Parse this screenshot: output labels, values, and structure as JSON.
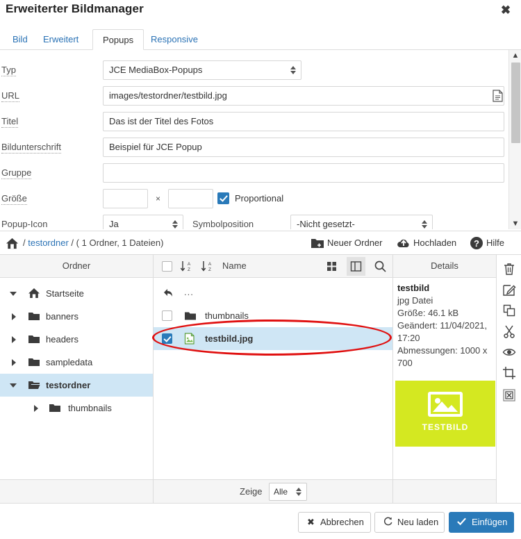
{
  "dialog": {
    "title": "Erweiterter Bildmanager",
    "close_icon": "close-icon"
  },
  "tabs": [
    {
      "label": "Bild",
      "active": false
    },
    {
      "label": "Erweitert",
      "active": false
    },
    {
      "label": "Popups",
      "active": true
    },
    {
      "label": "Responsive",
      "active": false
    }
  ],
  "form": {
    "typ": {
      "label": "Typ",
      "value": "JCE MediaBox-Popups"
    },
    "url": {
      "label": "URL",
      "value": "images/testordner/testbild.jpg",
      "browse_icon": "document-browse-icon"
    },
    "titel": {
      "label": "Titel",
      "value": "Das ist der Titel des Fotos"
    },
    "bildunterschrift": {
      "label": "Bildunterschrift",
      "value": "Beispiel für JCE Popup"
    },
    "gruppe": {
      "label": "Gruppe",
      "value": ""
    },
    "groesse": {
      "label": "Größe",
      "width_value": "",
      "height_value": "",
      "separator": "×",
      "proportional_label": "Proportional",
      "proportional_checked": true
    },
    "popup_icon": {
      "label": "Popup-Icon",
      "value": "Ja"
    },
    "symbolposition": {
      "label": "Symbolposition",
      "value": "-Nicht gesetzt-"
    }
  },
  "breadcrumb": {
    "home_icon": "home-icon",
    "sep1": "/",
    "folder": "testordner",
    "sep2": "/",
    "counts": "( 1 Ordner, 1 Dateien)"
  },
  "toolbar": [
    {
      "label": "Neuer Ordner",
      "icon": "new-folder-icon"
    },
    {
      "label": "Hochladen",
      "icon": "upload-cloud-icon"
    },
    {
      "label": "Hilfe",
      "icon": "help-icon"
    }
  ],
  "columns": {
    "folders": "Ordner",
    "name": "Name",
    "details": "Details"
  },
  "view_buttons": [
    {
      "icon": "grid-view-icon",
      "selected": false
    },
    {
      "icon": "list-view-icon",
      "selected": true
    },
    {
      "icon": "search-icon",
      "selected": false
    }
  ],
  "sort_buttons": [
    {
      "icon": "sort-asc-icon"
    },
    {
      "icon": "sort-desc-icon"
    }
  ],
  "folder_tree": [
    {
      "label": "Startseite",
      "icon": "home-icon",
      "caret": "down",
      "indent": 0,
      "selected": false,
      "bold": false
    },
    {
      "label": "banners",
      "icon": "folder-icon",
      "caret": "right",
      "indent": 0,
      "selected": false,
      "bold": false
    },
    {
      "label": "headers",
      "icon": "folder-icon",
      "caret": "right",
      "indent": 0,
      "selected": false,
      "bold": false
    },
    {
      "label": "sampledata",
      "icon": "folder-icon",
      "caret": "right",
      "indent": 0,
      "selected": false,
      "bold": false
    },
    {
      "label": "testordner",
      "icon": "folder-open-icon",
      "caret": "down",
      "indent": 0,
      "selected": true,
      "bold": true
    },
    {
      "label": "thumbnails",
      "icon": "folder-icon",
      "caret": "right",
      "indent": 1,
      "selected": false,
      "bold": false
    }
  ],
  "file_list": {
    "up_row": {
      "label": "...",
      "icon": "back-arrow-icon"
    },
    "rows": [
      {
        "label": "thumbnails",
        "icon": "folder-icon",
        "checked": false,
        "selected": false,
        "bold": false
      },
      {
        "label": "testbild.jpg",
        "icon": "image-file-icon",
        "checked": true,
        "selected": true,
        "bold": true
      }
    ]
  },
  "details": {
    "name": "testbild",
    "type": "jpg Datei",
    "size": "Größe: 46.1 kB",
    "modified": "Geändert: 11/04/2021, 17:20",
    "dimensions": "Abmessungen: 1000 x 700",
    "thumbnail_text": "TESTBILD",
    "thumbnail_color": "#d4e821"
  },
  "actions": [
    {
      "icon": "trash-icon"
    },
    {
      "icon": "edit-icon"
    },
    {
      "icon": "copy-icon"
    },
    {
      "icon": "cut-icon"
    },
    {
      "icon": "preview-eye-icon"
    },
    {
      "icon": "crop-icon"
    },
    {
      "icon": "paste-cancel-icon"
    }
  ],
  "files_footer": {
    "show_label": "Zeige",
    "show_value": "Alle"
  },
  "buttons": {
    "cancel": {
      "label": "Abbrechen",
      "icon": "x-icon"
    },
    "reload": {
      "label": "Neu laden",
      "icon": "refresh-icon"
    },
    "insert": {
      "label": "Einfügen",
      "icon": "check-icon"
    }
  },
  "colors": {
    "accent": "#2a7ab9",
    "link": "#2a72b5",
    "selection": "#cfe6f5",
    "annotation": "#e01010"
  }
}
